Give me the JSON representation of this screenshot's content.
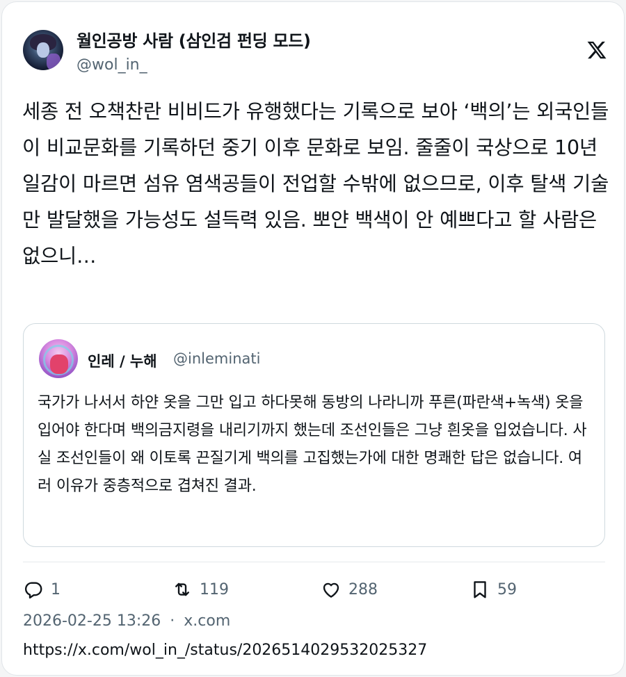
{
  "author": {
    "name": "월인공방 사람 (삼인검 펀딩 모드)",
    "handle": "@wol_in_"
  },
  "tweet": {
    "text": "세종 전 오책찬란 비비드가 유행했다는 기록으로 보아 ‘백의’는 외국인들이 비교문화를 기록하던 중기 이후 문화로 보임. 줄줄이 국상으로 10년 일감이 마르면 섬유 염색공들이 전업할 수밖에 없으므로, 이후 탈색 기술만 발달했을 가능성도 설득력 있음. 뽀얀 백색이 안 예쁘다고 할 사람은 없으니…"
  },
  "quote": {
    "name": "인레 / 누해",
    "handle": "@inleminati",
    "text": "국가가 나서서 하얀 옷을 그만 입고 하다못해 동방의 나라니까 푸른(파란색+녹색) 옷을 입어야 한다며 백의금지령을 내리기까지 했는데 조선인들은 그냥 흰옷을 입었습니다. 사실 조선인들이 왜 이토록 끈질기게 백의를 고집했는가에 대한 명쾌한 답은 없습니다. 여러 이유가 중층적으로 겹쳐진 결과."
  },
  "actions": {
    "replies": "1",
    "retweets": "119",
    "likes": "288",
    "bookmarks": "59"
  },
  "meta": {
    "timestamp": "2026-02-25 13:26",
    "separator": "·",
    "source": "x.com"
  },
  "url": "https://x.com/wol_in_/status/2026514029532025327",
  "icons": {
    "brand": "x-logo-icon",
    "reply": "reply-icon",
    "retweet": "retweet-icon",
    "like": "heart-icon",
    "bookmark": "bookmark-icon"
  },
  "colors": {
    "text": "#0f1419",
    "secondary": "#536471",
    "border": "#cfd9de"
  }
}
